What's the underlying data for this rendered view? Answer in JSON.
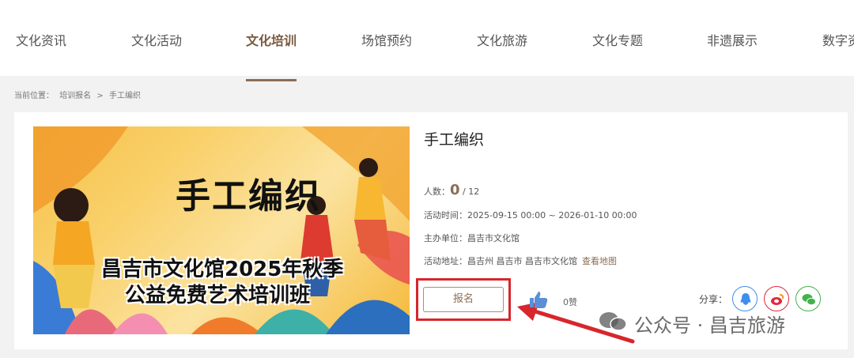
{
  "nav": {
    "items": [
      {
        "label": "文化资讯"
      },
      {
        "label": "文化活动"
      },
      {
        "label": "文化培训"
      },
      {
        "label": "场馆预约"
      },
      {
        "label": "文化旅游"
      },
      {
        "label": "文化专题"
      },
      {
        "label": "非遗展示"
      },
      {
        "label": "数字资"
      }
    ],
    "active_index": 2
  },
  "breadcrumb": {
    "prefix": "当前位置：",
    "crumb1": "培训报名",
    "separator": ">",
    "crumb2": "手工编织"
  },
  "banner": {
    "title": "手工编织",
    "line1": "昌吉市文化馆2025年秋季",
    "line2": "公益免费艺术培训班"
  },
  "detail": {
    "title": "手工编织",
    "people_label": "人数：",
    "people_current": "0",
    "people_total": " / 12",
    "time_label": "活动时间：",
    "time_value": "2025-09-15 00:00 ~ 2026-01-10 00:00",
    "organizer_label": "主办单位：",
    "organizer_value": "昌吉市文化馆",
    "address_label": "活动地址：",
    "address_value": "昌吉州 昌吉市 昌吉市文化馆",
    "map_link": "查看地图"
  },
  "actions": {
    "signup_label": "报名",
    "like_count": "0赞",
    "share_label": "分享："
  },
  "icons": {
    "like": "thumbs-up-icon",
    "share": [
      "qq-icon",
      "weibo-icon",
      "wechat-icon"
    ]
  },
  "colors": {
    "accent": "#8b6d56",
    "highlight": "#d7262c",
    "qq": "#3d8ef0",
    "weibo": "#e2273c",
    "wechat": "#3fb44a"
  },
  "watermark": "公众号 · 昌吉旅游"
}
